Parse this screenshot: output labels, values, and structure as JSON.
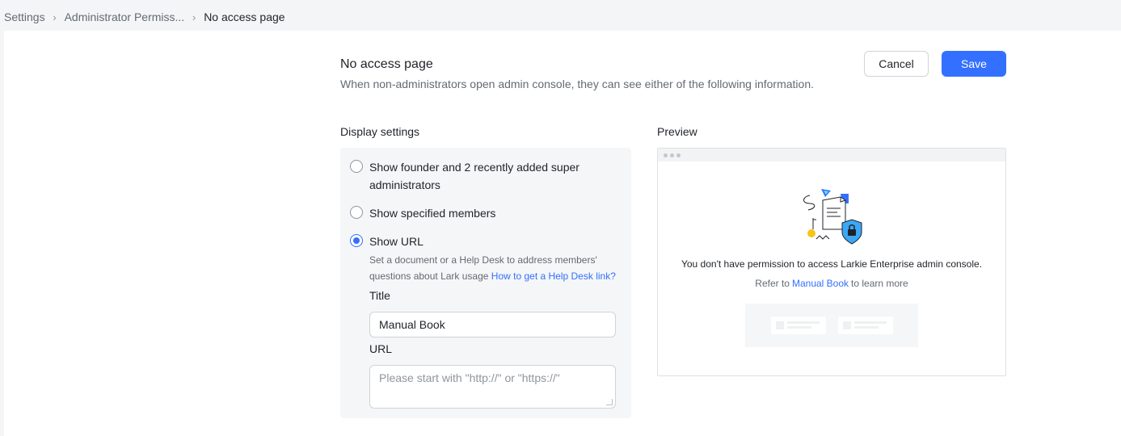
{
  "breadcrumb": {
    "items": [
      "Settings",
      "Administrator Permiss...",
      "No access page"
    ]
  },
  "header": {
    "title": "No access page",
    "description": "When non-administrators open admin console, they can see either of the following information.",
    "cancel_label": "Cancel",
    "save_label": "Save"
  },
  "display_settings": {
    "label": "Display settings",
    "options": [
      {
        "label": "Show founder and 2 recently added super administrators",
        "selected": false
      },
      {
        "label": "Show specified members",
        "selected": false
      },
      {
        "label": "Show URL",
        "selected": true
      }
    ],
    "hint_text": "Set a document or a Help Desk to address members' questions about Lark usage",
    "hint_link": "How to get a Help Desk link?",
    "title_label": "Title",
    "title_value": "Manual Book",
    "url_label": "URL",
    "url_placeholder": "Please start with \"http://\" or \"https://\""
  },
  "preview": {
    "label": "Preview",
    "message": "You don't have permission to access Larkie Enterprise admin console.",
    "refer_prefix": "Refer to",
    "refer_link": "Manual Book",
    "refer_suffix": "to learn more"
  },
  "colors": {
    "accent": "#3370ff",
    "background": "#f4f5f6",
    "panel": "#ffffff"
  },
  "icons": [
    "chevron-right-icon",
    "no-access-illustration"
  ]
}
